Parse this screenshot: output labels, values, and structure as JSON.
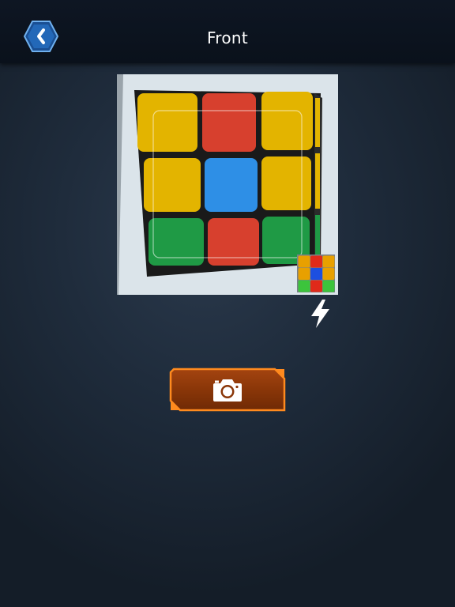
{
  "header": {
    "title": "Front",
    "back_icon": "chevron-left-icon"
  },
  "preview": {
    "face_colors": [
      [
        "#e3b400",
        "#d7402e",
        "#e3b400"
      ],
      [
        "#e3b400",
        "#2e8fe6",
        "#e3b400"
      ],
      [
        "#1f9a45",
        "#d7402e",
        "#1f9a45"
      ]
    ],
    "thumbnail_colors": [
      [
        "#e8a000",
        "#e02a1a",
        "#e8a000"
      ],
      [
        "#e8a000",
        "#1d4fe0",
        "#e8a000"
      ],
      [
        "#3cc43c",
        "#e02a1a",
        "#3cc43c"
      ]
    ]
  },
  "controls": {
    "flash_icon": "lightning-icon",
    "capture_icon": "camera-icon"
  },
  "colors": {
    "accent_orange": "#e9741c",
    "back_button_blue": "#1f5fae"
  }
}
